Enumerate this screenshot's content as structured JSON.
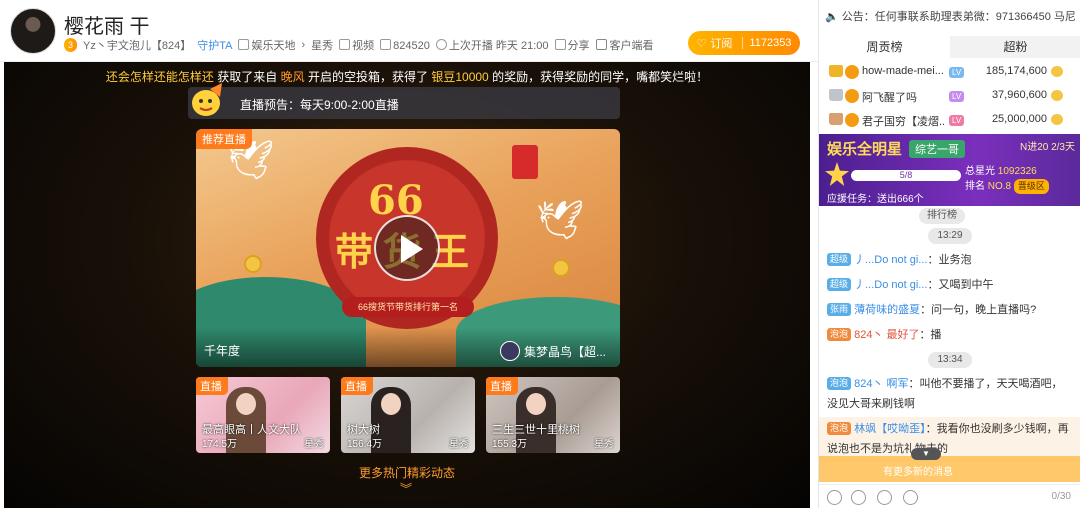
{
  "header": {
    "title": "樱花雨 干",
    "level_badge": "3",
    "owner": "Yz丶宇文泡儿【824】",
    "guard_link": "守护TA",
    "category": "娱乐天地",
    "subcategory": "星秀",
    "tag_video": "视频",
    "room_id": "824520",
    "last_live": "上次开播 昨天 21:00",
    "share": "分享",
    "client_watch": "客户端看",
    "follow_label": "订阅",
    "follow_count": "1172353"
  },
  "stage": {
    "banner_parts": [
      "还会怎样还能怎样还",
      "获取了来自",
      "晚风",
      "开启的空投箱，获得了",
      "银豆10000",
      "的奖励，获得奖励的同学，嘴都笑烂啦！"
    ],
    "preview": "直播预告：每天9:00-2:00直播",
    "main_card": {
      "tag": "推荐直播",
      "big_number": "66",
      "big_text": "带货王",
      "ribbon": "66搜货节带货排行第一名",
      "title": "千年度",
      "anchor": "集梦晶鸟【超..."
    },
    "thumbs": [
      {
        "live": "直播",
        "name": "最高眼高丨人文大队",
        "views": "174.5万",
        "cat": "星秀"
      },
      {
        "live": "直播",
        "name": "树大树",
        "views": "156.4万",
        "cat": "星秀"
      },
      {
        "live": "直播",
        "name": "三生三世十里桃树",
        "views": "155.3万",
        "cat": "星秀"
      }
    ],
    "more": "更多热门精彩动态"
  },
  "sidebar": {
    "notice": "公告：任何事联系助理表弟微：971366450 马尼",
    "tabs": [
      "周贡榜",
      "超粉"
    ],
    "rank": [
      {
        "name": "how-made-mei...",
        "score": "185,174,600",
        "crown_color": "#f0b429",
        "level_color": "#7cb8f0"
      },
      {
        "name": "阿飞醒了吗",
        "score": "37,960,600",
        "crown_color": "#c0c4cc",
        "level_color": "#c58cf0"
      },
      {
        "name": "君子国穷【凌熠...",
        "score": "25,000,000",
        "crown_color": "#d8a070",
        "level_color": "#f07aa6"
      }
    ],
    "promo": {
      "title": "娱乐全明星",
      "tag": "综艺一哥",
      "stage": "N进20 2/3天",
      "progress": "5/8",
      "progress_fraction": 0.625,
      "star_total_label": "总星光",
      "star_total": "1092326",
      "rank_label": "排名",
      "rank_value": "NO.8",
      "area": "晋级区",
      "task": "应援任务：送出666个",
      "button": "排行榜"
    },
    "chat": [
      {
        "type": "time",
        "text": "13:29"
      },
      {
        "type": "msg",
        "fan": "超级",
        "who": "丿...Do not gi...",
        "text": "：业务泡"
      },
      {
        "type": "msg",
        "fan": "超级",
        "who": "丿...Do not gi...",
        "text": "：又喝到中午"
      },
      {
        "type": "msg",
        "fan": "张雨",
        "who": "薄荷味的盛夏",
        "text": "：问一句，晚上直播吗?"
      },
      {
        "type": "msg_red",
        "fan": "泡泡",
        "who": "824丶",
        "who2": "最好了",
        "text": "：播"
      },
      {
        "type": "time",
        "text": "13:34"
      },
      {
        "type": "msg2",
        "fan": "泡泡",
        "who": "824丶",
        "who2": "啊军",
        "text": "：叫他不要播了，天天喝酒吧，没见大哥来刷钱啊"
      },
      {
        "type": "msg_hl",
        "fan": "泡泡",
        "who": "林飒【哎呦歪】",
        "text": "：我看你也没刷多少钱啊，再说泡也不是为坑礼物去的"
      }
    ],
    "new_msg": "有更多新的消息",
    "input_count": "0/30"
  }
}
